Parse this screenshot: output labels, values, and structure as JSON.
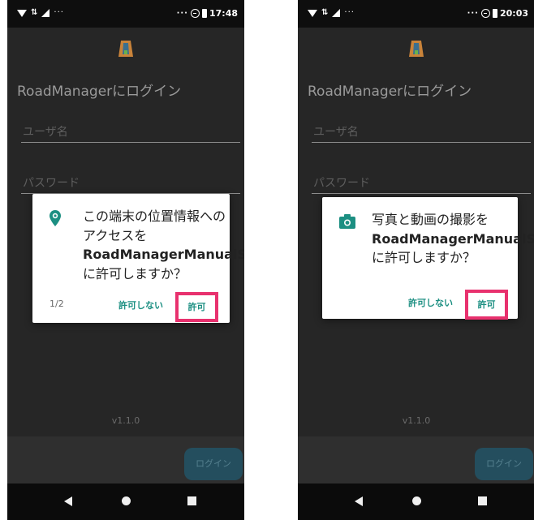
{
  "colors": {
    "screen_background": "#262626",
    "accent": "#1c8f82",
    "highlight": "#e8316e",
    "login_button": "#244e5e",
    "logo": "#c9833a"
  },
  "screens": [
    {
      "status_bar": {
        "time": "17:48",
        "overflow": "···"
      },
      "app": {
        "title": "RoadManagerにログイン",
        "username_placeholder": "ユーザ名",
        "password_placeholder": "パスワード",
        "version": "v1.1.0",
        "login_button": "ログイン"
      },
      "dialog": {
        "icon": "location-pin-icon",
        "message_before": "この端末の位置情報へのアクセスを ",
        "app_name": "RoadManagerManualSh...",
        "message_after": " に許可しますか？",
        "counter": "1/2",
        "deny_label": "許可しない",
        "allow_label": "許可"
      }
    },
    {
      "status_bar": {
        "time": "20:03",
        "overflow": "···"
      },
      "app": {
        "title": "RoadManagerにログイン",
        "username_placeholder": "ユーザ名",
        "password_placeholder": "パスワード",
        "version": "v1.1.0",
        "login_button": "ログイン"
      },
      "dialog": {
        "icon": "camera-icon",
        "message_before": "写真と動画の撮影を ",
        "app_name": "RoadManagerManualSh...",
        "message_after": " に許可しますか？",
        "deny_label": "許可しない",
        "allow_label": "許可"
      }
    }
  ]
}
